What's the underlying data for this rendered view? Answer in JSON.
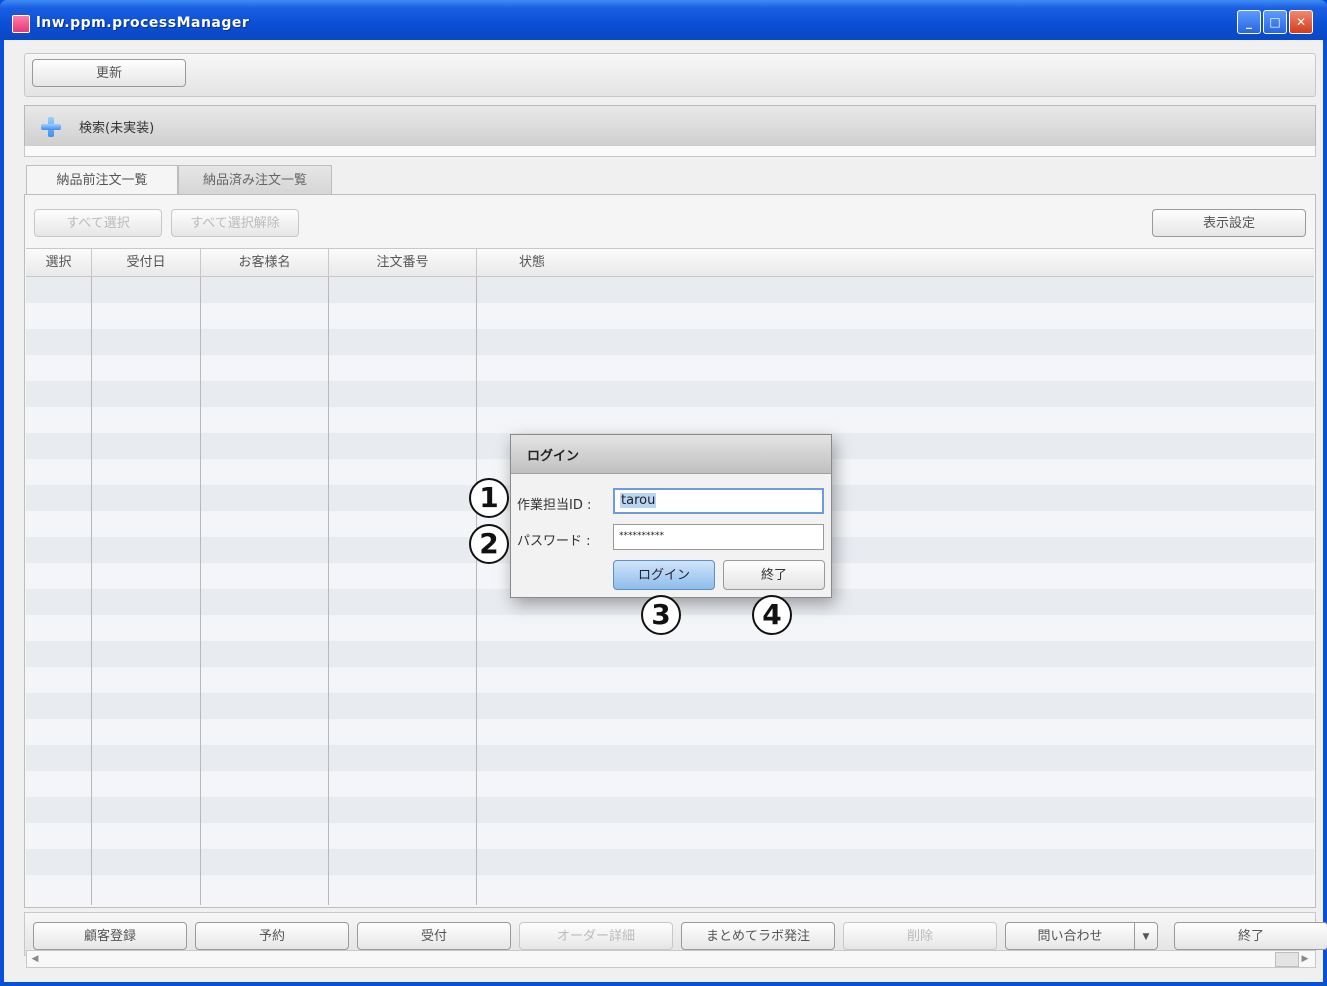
{
  "window": {
    "title": "lnw.ppm.processManager",
    "controls": [
      "minimize-icon",
      "maximize-icon",
      "close-icon"
    ]
  },
  "toolbar": {
    "refresh_label": "更新"
  },
  "search": {
    "label": "検索(未実装)",
    "icon": "plus-icon"
  },
  "tabs": [
    {
      "label": "納品前注文一覧",
      "active": true
    },
    {
      "label": "納品済み注文一覧",
      "active": false
    }
  ],
  "actions": {
    "select_all": "すべて選択",
    "deselect_all": "すべて選択解除",
    "display_settings": "表示設定"
  },
  "table": {
    "columns": [
      "選択",
      "受付日",
      "お客様名",
      "注文番号",
      "状態"
    ],
    "rows": []
  },
  "bottom_buttons": [
    {
      "label": "顧客登録",
      "enabled": true
    },
    {
      "label": "予約",
      "enabled": true
    },
    {
      "label": "受付",
      "enabled": true
    },
    {
      "label": "オーダー詳細",
      "enabled": false
    },
    {
      "label": "まとめてラボ発注",
      "enabled": true
    },
    {
      "label": "削除",
      "enabled": false
    },
    {
      "label": "問い合わせ",
      "enabled": true,
      "has_dropdown": true
    },
    {
      "label": "終了",
      "enabled": true
    }
  ],
  "login_dialog": {
    "title": "ログイン",
    "user_id_label": "作業担当ID :",
    "user_id_value": "tarou",
    "password_label": "パスワード :",
    "password_value": "**********",
    "login_button": "ログイン",
    "exit_button": "終了"
  },
  "callouts": [
    "1",
    "2",
    "3",
    "4"
  ],
  "colors": {
    "titlebar": "#0b4fd6",
    "row_alt": "#e8ecf1",
    "primary_button": "#8fbde9"
  }
}
